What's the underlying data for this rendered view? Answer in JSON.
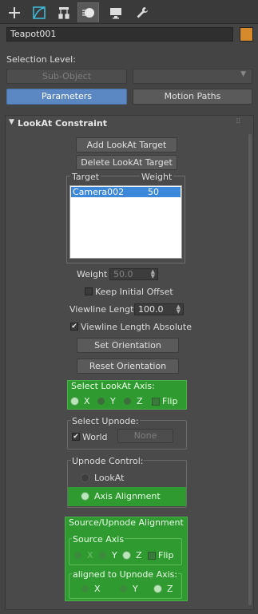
{
  "object_name": "Teapot001",
  "object_color": "#d78a2c",
  "selection_level_label": "Selection Level:",
  "sub_object_label": "Sub-Object",
  "parameters_tab": "Parameters",
  "motion_paths_tab": "Motion Paths",
  "rollout_title": "LookAt Constraint",
  "add_target_label": "Add LookAt Target",
  "delete_target_label": "Delete LookAt Target",
  "list_headers": {
    "target": "Target",
    "weight": "Weight"
  },
  "targets": [
    {
      "name": "Camera002",
      "weight": "50"
    }
  ],
  "weight_label": "Weight",
  "weight_value": "50.0",
  "keep_offset_label": "Keep Initial Offset",
  "keep_offset_checked": false,
  "viewline_length_label": "Viewline Length",
  "viewline_length_value": "100.0",
  "viewline_absolute_label": "Viewline Length Absolute",
  "viewline_absolute_checked": true,
  "set_orientation_label": "Set Orientation",
  "reset_orientation_label": "Reset Orientation",
  "select_axis": {
    "title": "Select LookAt Axis:",
    "x": "X",
    "y": "Y",
    "z": "Z",
    "selected": "X",
    "flip_label": "Flip",
    "flip_checked": false
  },
  "select_upnode": {
    "title": "Select Upnode:",
    "world_label": "World",
    "world_checked": true,
    "none_label": "None"
  },
  "upnode_control": {
    "title": "Upnode Control:",
    "lookat_label": "LookAt",
    "axis_alignment_label": "Axis Alignment",
    "selected": "Axis Alignment"
  },
  "source_upnode": {
    "title": "Source/Upnode Alignment",
    "source_axis_title": "Source Axis",
    "source_x": "X",
    "source_y": "Y",
    "source_z": "Z",
    "source_selected": "Z",
    "flip_label": "Flip",
    "flip_checked": false,
    "aligned_title": "aligned to Upnode Axis:",
    "aligned_x": "X",
    "aligned_y": "Y",
    "aligned_z": "Z",
    "aligned_selected": "Z"
  },
  "colors": {
    "accent_blue": "#5b87c3",
    "group_green": "#2f9a2f",
    "selection_blue": "#3b87d9"
  }
}
